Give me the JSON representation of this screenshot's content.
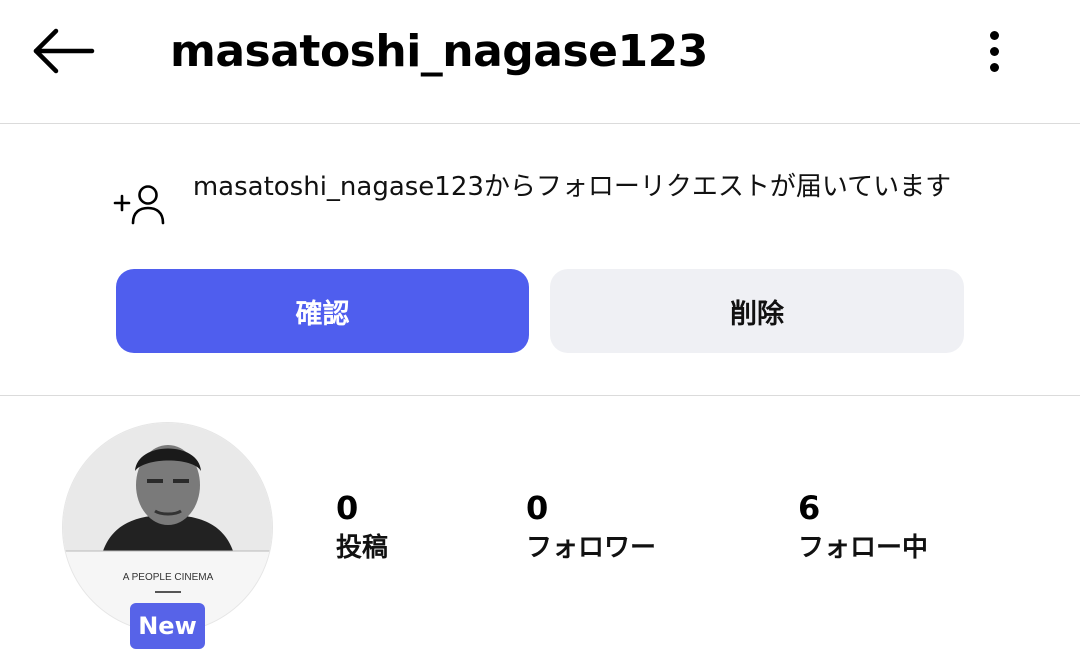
{
  "header": {
    "username": "masatoshi_nagase123",
    "back_icon": "arrow-left-icon",
    "menu_icon": "more-vertical-icon"
  },
  "follow_request": {
    "icon": "add-person-icon",
    "message": "masatoshi_nagase123からフォローリクエストが届いています",
    "confirm_label": "確認",
    "delete_label": "削除",
    "confirm_color": "#4f5eee",
    "delete_color": "#eff0f4"
  },
  "profile": {
    "avatar_caption": "A PEOPLE CINEMA",
    "badge": "New",
    "badge_color": "#5763e8",
    "stats": [
      {
        "value": "0",
        "label": "投稿"
      },
      {
        "value": "0",
        "label": "フォロワー"
      },
      {
        "value": "6",
        "label": "フォロー中"
      }
    ]
  }
}
